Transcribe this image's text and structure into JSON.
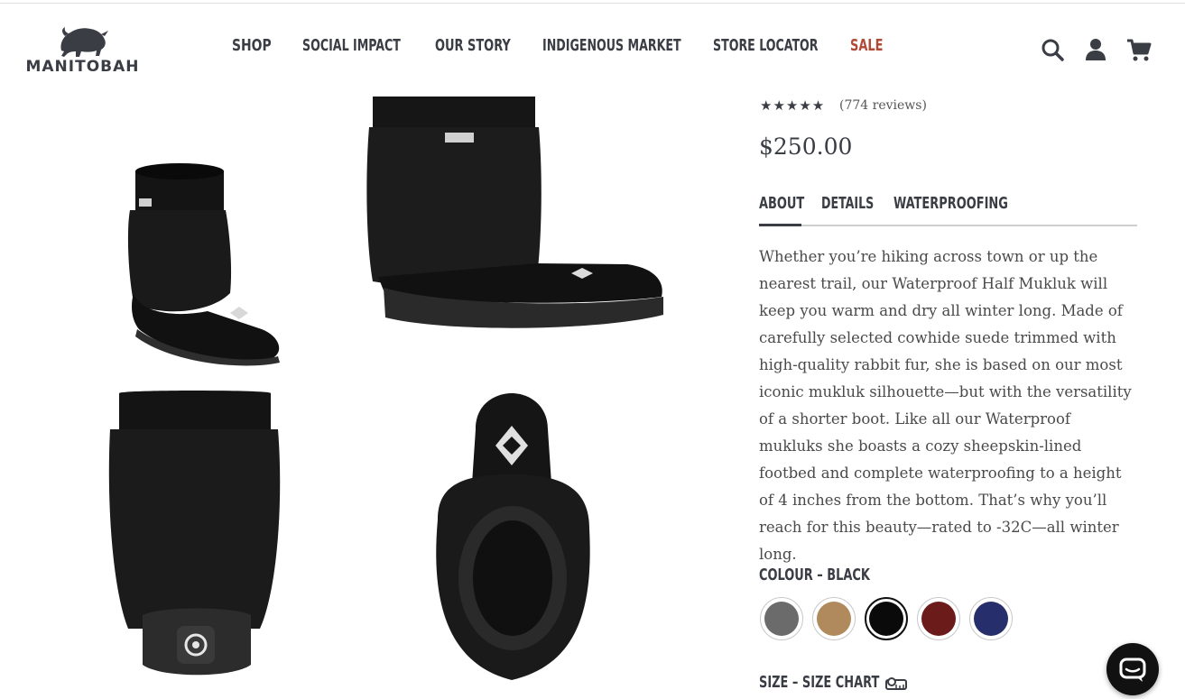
{
  "header": {
    "logo_text": "MANITOBAH",
    "nav": [
      {
        "label": "SHOP"
      },
      {
        "label": "SOCIAL IMPACT"
      },
      {
        "label": "OUR STORY"
      },
      {
        "label": "INDIGENOUS MARKET"
      },
      {
        "label": "STORE LOCATOR"
      },
      {
        "label": "SALE"
      }
    ],
    "icons": [
      "search-icon",
      "account-icon",
      "cart-icon"
    ]
  },
  "product": {
    "stars": "★★★★★",
    "rating": 5,
    "reviews": "(774 reviews)",
    "price": "$250.00",
    "tabs": [
      "ABOUT",
      "DETAILS",
      "WATERPROOFING"
    ],
    "active_tab": "ABOUT",
    "description": "Whether you’re hiking across town or up the nearest trail, our Waterproof Half Mukluk will keep you warm and dry all winter long. Made of carefully selected cowhide suede trimmed with high-quality rabbit fur, she is based on our most iconic mukluk silhouette—but with the versatility of a shorter boot. Like all our Waterproof mukluks she boasts a cozy sheepskin-lined footbed and complete waterproofing to a height of 4 inches from the bottom. That’s why you’ll reach for this beauty—rated to -32C—all winter long.",
    "colour_label": "COLOUR – BLACK",
    "swatches": [
      {
        "color": "#6b6b6b",
        "selected": false
      },
      {
        "color": "#b08a5c",
        "selected": false
      },
      {
        "color": "#0a0a0a",
        "selected": true
      },
      {
        "color": "#6b1c1a",
        "selected": false
      },
      {
        "color": "#262e6b",
        "selected": false
      }
    ],
    "size_label": "SIZE – SIZE CHART"
  },
  "colors": {
    "nav_text": "#3a3d44",
    "sale": "#b04a37"
  }
}
